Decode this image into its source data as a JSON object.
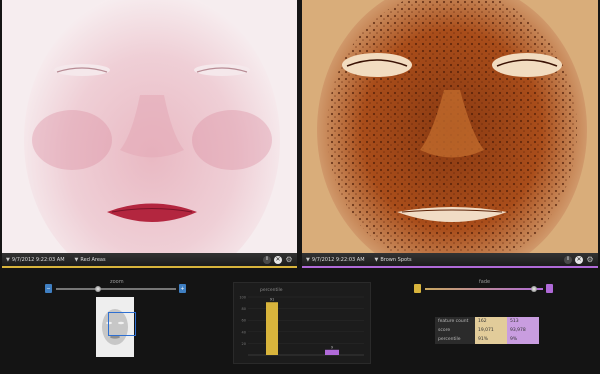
{
  "left_panel": {
    "date": "9/7/2012 9:22:03 AM",
    "mode": "Red Areas",
    "accent": "#d8b43c"
  },
  "right_panel": {
    "date": "9/7/2012 9:22:03 AM",
    "mode": "Brown Spots",
    "accent": "#b06ad8"
  },
  "icons": {
    "info": "i",
    "close": "✕",
    "gear": "⚙"
  },
  "zoom": {
    "label": "zoom",
    "level": 0.35,
    "minus": "−",
    "plus": "+"
  },
  "fade": {
    "label": "fade",
    "level": 0.92
  },
  "chart_data": {
    "type": "bar",
    "title": "percentile",
    "categories": [
      "Red Areas",
      "Brown Spots"
    ],
    "values": [
      91,
      9
    ],
    "ylim": [
      0,
      100
    ],
    "yticks": [
      100,
      80,
      60,
      40,
      20
    ],
    "data_labels": [
      "91",
      "9"
    ],
    "colors": [
      "#d8b43c",
      "#b06ad8"
    ]
  },
  "stats": {
    "rows": [
      {
        "label": "feature count",
        "v1": "162",
        "v2": "513"
      },
      {
        "label": "score",
        "v1": "19,071",
        "v2": "93,978"
      },
      {
        "label": "percentile",
        "v1": "91%",
        "v2": "9%"
      }
    ]
  }
}
